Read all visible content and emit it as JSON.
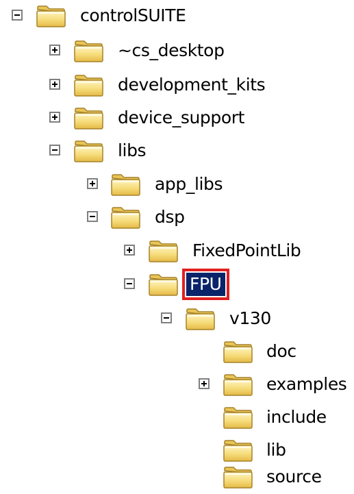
{
  "tree": {
    "root": {
      "label": "controlSUITE",
      "expanded": true
    },
    "items": [
      {
        "label": "~cs_desktop",
        "toggle": "plus"
      },
      {
        "label": "development_kits",
        "toggle": "plus"
      },
      {
        "label": "device_support",
        "toggle": "plus"
      },
      {
        "label": "libs",
        "toggle": "minus"
      },
      {
        "label": "app_libs",
        "toggle": "plus"
      },
      {
        "label": "dsp",
        "toggle": "minus"
      },
      {
        "label": "FixedPointLib",
        "toggle": "plus"
      },
      {
        "label": "FPU",
        "toggle": "minus",
        "selected": true
      },
      {
        "label": "v130",
        "toggle": "minus"
      },
      {
        "label": "doc",
        "toggle": "none"
      },
      {
        "label": "examples",
        "toggle": "plus"
      },
      {
        "label": "include",
        "toggle": "none"
      },
      {
        "label": "lib",
        "toggle": "none"
      },
      {
        "label": "source",
        "toggle": "none"
      }
    ],
    "selection_highlight_color": "#e02020",
    "folder_icon": "folder-icon"
  }
}
